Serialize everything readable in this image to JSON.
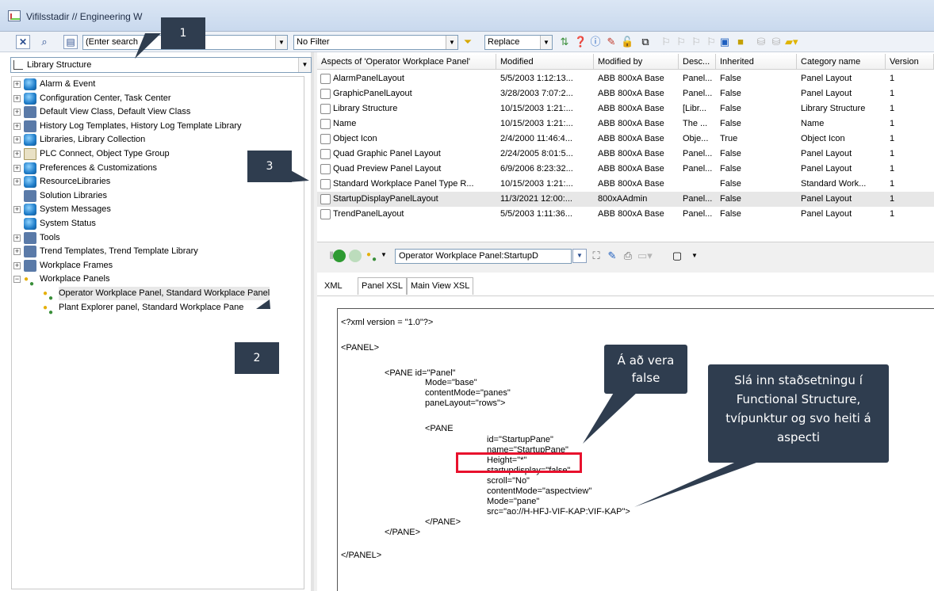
{
  "window": {
    "title": "Vifilsstadir // Engineering W"
  },
  "toolbar": {
    "search_placeholder": "(Enter search",
    "filter_value": "No Filter",
    "mode_value": "Replace"
  },
  "left": {
    "structure_combo": "Library Structure",
    "tree": [
      {
        "label": "Alarm & Event",
        "icon": "cube-icon",
        "expander": "+",
        "indent": 0
      },
      {
        "label": "Configuration Center, Task Center",
        "icon": "cube-icon",
        "expander": "+",
        "indent": 0
      },
      {
        "label": "Default View Class, Default View Class",
        "icon": "view-class-icon",
        "expander": "+",
        "indent": 0
      },
      {
        "label": "History Log Templates, History Log Template Library",
        "icon": "history-log-icon",
        "expander": "+",
        "indent": 0
      },
      {
        "label": "Libraries, Library Collection",
        "icon": "cube-icon",
        "expander": "+",
        "indent": 0
      },
      {
        "label": "PLC Connect, Object Type Group",
        "icon": "folder-icon",
        "expander": "+",
        "indent": 0
      },
      {
        "label": "Preferences & Customizations",
        "icon": "cube-icon",
        "expander": "+",
        "indent": 0
      },
      {
        "label": "ResourceLibraries",
        "icon": "cube-icon",
        "expander": "+",
        "indent": 0
      },
      {
        "label": "Solution Libraries",
        "icon": "solution-libraries-icon",
        "expander": "",
        "indent": 0
      },
      {
        "label": "System Messages",
        "icon": "cube-icon",
        "expander": "+",
        "indent": 0
      },
      {
        "label": "System Status",
        "icon": "cube-icon",
        "expander": "",
        "indent": 0
      },
      {
        "label": "Tools",
        "icon": "tools-icon",
        "expander": "+",
        "indent": 0
      },
      {
        "label": "Trend Templates, Trend Template Library",
        "icon": "trend-icon",
        "expander": "+",
        "indent": 0
      },
      {
        "label": "Workplace Frames",
        "icon": "frames-icon",
        "expander": "+",
        "indent": 0
      },
      {
        "label": "Workplace Panels",
        "icon": "panels-icon",
        "expander": "−",
        "indent": 0
      },
      {
        "label": "Operator Workplace Panel, Standard Workplace Panel",
        "icon": "panels-icon",
        "expander": "",
        "indent": 1
      },
      {
        "label": "Plant Explorer panel, Standard Workplace Pane",
        "icon": "panels-icon",
        "expander": "",
        "indent": 1
      }
    ]
  },
  "aspects": {
    "columns": [
      "Aspects of 'Operator Workplace Panel'",
      "Modified",
      "Modified by",
      "Desc...",
      "Inherited",
      "Category name",
      "Version"
    ],
    "rows": [
      [
        "AlarmPanelLayout",
        "5/5/2003 1:12:13...",
        "ABB 800xA Base",
        "Panel...",
        "False",
        "Panel Layout",
        "1"
      ],
      [
        "GraphicPanelLayout",
        "3/28/2003 7:07:2...",
        "ABB 800xA Base",
        "Panel...",
        "False",
        "Panel Layout",
        "1"
      ],
      [
        "Library Structure",
        "10/15/2003 1:21:...",
        "ABB 800xA Base",
        "[Libr...",
        "False",
        "Library Structure",
        "1"
      ],
      [
        "Name",
        "10/15/2003 1:21:...",
        "ABB 800xA Base",
        "The ...",
        "False",
        "Name",
        "1"
      ],
      [
        "Object Icon",
        "2/4/2000 11:46:4...",
        "ABB 800xA Base",
        "Obje...",
        "True",
        "Object Icon",
        "1"
      ],
      [
        "Quad Graphic Panel Layout",
        "2/24/2005 8:01:5...",
        "ABB 800xA Base",
        "Panel...",
        "False",
        "Panel Layout",
        "1"
      ],
      [
        "Quad Preview Panel Layout",
        "6/9/2006 8:23:32...",
        "ABB 800xA Base",
        "Panel...",
        "False",
        "Panel Layout",
        "1"
      ],
      [
        "Standard Workplace Panel Type R...",
        "10/15/2003 1:21:...",
        "ABB 800xA Base",
        "",
        "False",
        "Standard Work...",
        "1"
      ],
      [
        "StartupDisplayPanelLayout",
        "11/3/2021 12:00:...",
        "800xAAdmin",
        "Panel...",
        "False",
        "Panel Layout",
        "1"
      ],
      [
        "TrendPanelLayout",
        "5/5/2003 1:11:36...",
        "ABB 800xA Base",
        "Panel...",
        "False",
        "Panel Layout",
        "1"
      ]
    ]
  },
  "aspect_view": {
    "combo": "Operator Workplace Panel:StartupD"
  },
  "tabs": [
    "XML",
    "Panel XSL",
    "Main View XSL"
  ],
  "xml": [
    "<?xml version = \"1.0\"?>",
    "<PANEL>",
    "<PANE id=\"Panel\"",
    "Mode=\"base\"",
    "contentMode=\"panes\"",
    "paneLayout=\"rows\">",
    "<PANE",
    "id=\"StartupPane\"",
    "name=\"StartupPane\"",
    "Height=\"*\"",
    "startupdisplay=\"false\"",
    "scroll=\"No\"",
    "contentMode=\"aspectview\"",
    "Mode=\"pane\"",
    "src=\"ao://H-HFJ-VIF-KAP:VIF-KAP\">",
    "</PANE>",
    "</PANE>",
    "</PANEL>"
  ],
  "annotations": {
    "badge1": "1",
    "badge2": "2",
    "badge3": "3",
    "callout_false": "Á að vera false",
    "callout_location": "Slá inn staðsetningu í Functional Structure, tvípunktur og svo heiti á aspecti"
  },
  "colors": {
    "callout_bg": "#2f3d4f",
    "highlight": "#e8112d"
  }
}
